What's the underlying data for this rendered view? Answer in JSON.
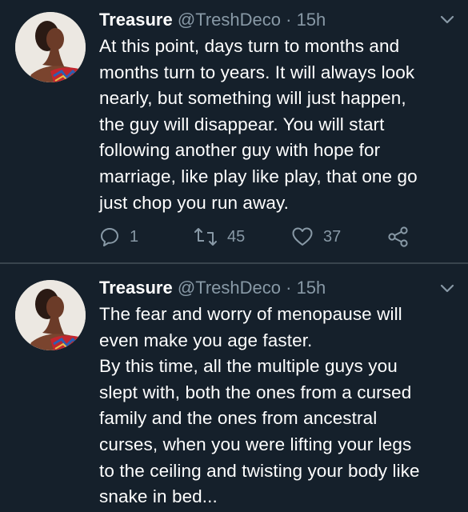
{
  "tweets": [
    {
      "author_name": "Treasure",
      "handle": "@TreshDeco",
      "separator": "·",
      "time": "15h",
      "lines": [
        "At this point, days turn to months and",
        "months turn to years. It will always look",
        "nearly, but something will just happen,",
        "the guy will disappear. You will start",
        "following another guy with hope for",
        "marriage, like play like play, that one go",
        "just chop you run away."
      ],
      "reply_count": "1",
      "retweet_count": "45",
      "like_count": "37"
    },
    {
      "author_name": "Treasure",
      "handle": "@TreshDeco",
      "separator": "·",
      "time": "15h",
      "lines": [
        "The fear and worry of menopause will",
        "even make you age faster.",
        "By this time, all the multiple guys you",
        "slept with, both the ones from a cursed",
        "family and the ones from ancestral",
        "curses, when you were lifting your legs",
        "to the ceiling and twisting your body like",
        "snake in bed..."
      ]
    }
  ],
  "icons": {
    "menu": "chevron-down-icon",
    "reply": "reply-icon",
    "retweet": "retweet-icon",
    "like": "heart-icon",
    "share": "share-icon"
  },
  "colors": {
    "background": "#15202b",
    "text": "#ffffff",
    "secondary": "#8899a6",
    "divider": "#38444d"
  }
}
